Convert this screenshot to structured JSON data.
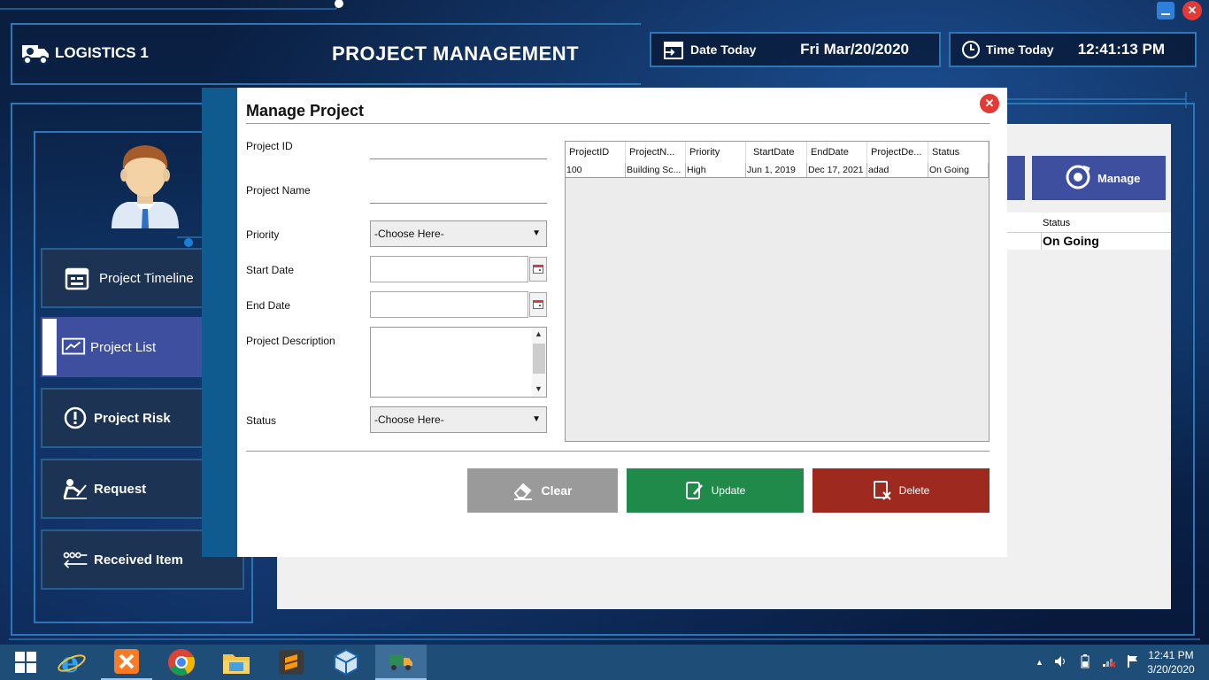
{
  "app": {
    "brand": "LOGISTICS 1",
    "title": "PROJECT MANAGEMENT",
    "date_label": "Date Today",
    "date_value": "Fri Mar/20/2020",
    "time_label": "Time Today",
    "time_value": "12:41:13 PM"
  },
  "sidebar": {
    "items": [
      {
        "label": "Project Timeline",
        "icon": "calendar-icon"
      },
      {
        "label": "Project List",
        "icon": "chart-icon"
      },
      {
        "label": "Project Risk",
        "icon": "alert-icon"
      },
      {
        "label": "Request",
        "icon": "request-icon"
      },
      {
        "label": "Received Item",
        "icon": "transfer-icon"
      }
    ]
  },
  "background": {
    "manage_label": "Manage",
    "status_header": "Status",
    "status_value": "On Going"
  },
  "modal": {
    "title": "Manage Project",
    "fields": {
      "project_id": "Project ID",
      "project_name": "Project Name",
      "priority": "Priority",
      "start_date": "Start Date",
      "end_date": "End Date",
      "description": "Project Description",
      "status": "Status"
    },
    "priority_selected": "-Choose Here-",
    "status_selected": "-Choose Here-",
    "table": {
      "columns": [
        "ProjectID",
        "ProjectN...",
        "Priority",
        "StartDate",
        "EndDate",
        "ProjectDe...",
        "Status"
      ],
      "rows": [
        [
          "100",
          "Building Sc...",
          "High",
          "Jun 1, 2019",
          "Dec 17, 2021",
          "adad",
          "On Going"
        ]
      ]
    },
    "buttons": {
      "clear": "Clear",
      "update": "Update",
      "delete": "Delete"
    }
  },
  "taskbar": {
    "time": "12:41 PM",
    "date": "3/20/2020"
  }
}
